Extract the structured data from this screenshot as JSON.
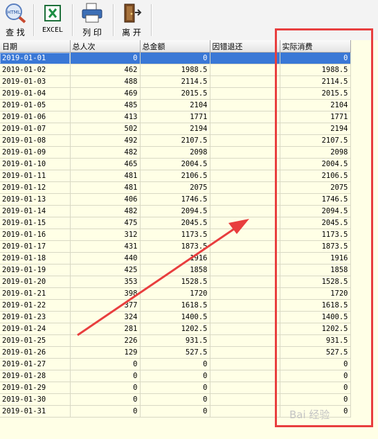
{
  "toolbar": {
    "search_label": "查 找",
    "excel_label": "EXCEL",
    "print_label": "列 印",
    "exit_label": "离 开",
    "search_icon_text": "HTML"
  },
  "table": {
    "columns": [
      "日期",
      "总人次",
      "总金额",
      "因错退还",
      "实际消费"
    ],
    "rows": [
      [
        "2019-01-01",
        "0",
        "0",
        "",
        "0"
      ],
      [
        "2019-01-02",
        "462",
        "1988.5",
        "",
        "1988.5"
      ],
      [
        "2019-01-03",
        "488",
        "2114.5",
        "",
        "2114.5"
      ],
      [
        "2019-01-04",
        "469",
        "2015.5",
        "",
        "2015.5"
      ],
      [
        "2019-01-05",
        "485",
        "2104",
        "",
        "2104"
      ],
      [
        "2019-01-06",
        "413",
        "1771",
        "",
        "1771"
      ],
      [
        "2019-01-07",
        "502",
        "2194",
        "",
        "2194"
      ],
      [
        "2019-01-08",
        "492",
        "2107.5",
        "",
        "2107.5"
      ],
      [
        "2019-01-09",
        "482",
        "2098",
        "",
        "2098"
      ],
      [
        "2019-01-10",
        "465",
        "2004.5",
        "",
        "2004.5"
      ],
      [
        "2019-01-11",
        "481",
        "2106.5",
        "",
        "2106.5"
      ],
      [
        "2019-01-12",
        "481",
        "2075",
        "",
        "2075"
      ],
      [
        "2019-01-13",
        "406",
        "1746.5",
        "",
        "1746.5"
      ],
      [
        "2019-01-14",
        "482",
        "2094.5",
        "",
        "2094.5"
      ],
      [
        "2019-01-15",
        "475",
        "2045.5",
        "",
        "2045.5"
      ],
      [
        "2019-01-16",
        "312",
        "1173.5",
        "",
        "1173.5"
      ],
      [
        "2019-01-17",
        "431",
        "1873.5",
        "",
        "1873.5"
      ],
      [
        "2019-01-18",
        "440",
        "1916",
        "",
        "1916"
      ],
      [
        "2019-01-19",
        "425",
        "1858",
        "",
        "1858"
      ],
      [
        "2019-01-20",
        "353",
        "1528.5",
        "",
        "1528.5"
      ],
      [
        "2019-01-21",
        "398",
        "1720",
        "",
        "1720"
      ],
      [
        "2019-01-22",
        "377",
        "1618.5",
        "",
        "1618.5"
      ],
      [
        "2019-01-23",
        "324",
        "1400.5",
        "",
        "1400.5"
      ],
      [
        "2019-01-24",
        "281",
        "1202.5",
        "",
        "1202.5"
      ],
      [
        "2019-01-25",
        "226",
        "931.5",
        "",
        "931.5"
      ],
      [
        "2019-01-26",
        "129",
        "527.5",
        "",
        "527.5"
      ],
      [
        "2019-01-27",
        "0",
        "0",
        "",
        "0"
      ],
      [
        "2019-01-28",
        "0",
        "0",
        "",
        "0"
      ],
      [
        "2019-01-29",
        "0",
        "0",
        "",
        "0"
      ],
      [
        "2019-01-30",
        "0",
        "0",
        "",
        "0"
      ],
      [
        "2019-01-31",
        "0",
        "0",
        "",
        "0"
      ]
    ],
    "selected_row": 0
  },
  "annotation": {
    "color": "#e83e3e"
  },
  "watermark": "Bai 经验",
  "colors": {
    "grid_bg": "#ffffe6",
    "selection": "#3a78d6"
  }
}
